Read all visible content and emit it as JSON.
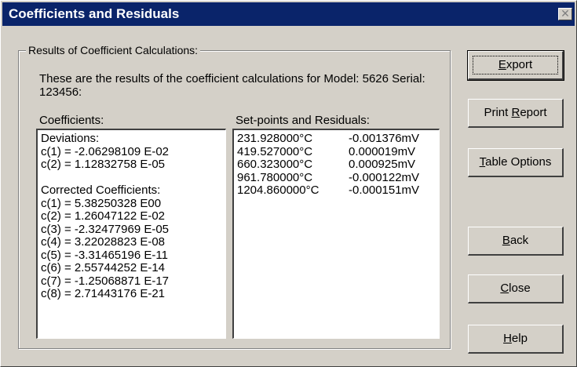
{
  "window": {
    "title": "Coefficients and Residuals",
    "close_glyph": "✕"
  },
  "group": {
    "legend": "Results of Coefficient Calculations:",
    "intro": "These are the results of the coefficient calculations for Model: 5626 Serial: 123456:"
  },
  "coefficients": {
    "label": "Coefficients:",
    "lines": [
      "Deviations:",
      "c(1) = -2.06298109 E-02",
      "c(2) = 1.12832758 E-05",
      "",
      "Corrected Coefficients:",
      "c(1) = 5.38250328 E00",
      "c(2) = 1.26047122 E-02",
      "c(3) = -2.32477969 E-05",
      "c(4) = 3.22028823 E-08",
      "c(5) = -3.31465196 E-11",
      "c(6) = 2.55744252 E-14",
      "c(7) = -1.25068871 E-17",
      "c(8) = 2.71443176 E-21"
    ]
  },
  "setpoints": {
    "label": "Set-points and Residuals:",
    "rows": [
      {
        "temp": "231.928000°C",
        "residual": "-0.001376mV"
      },
      {
        "temp": "419.527000°C",
        "residual": "0.000019mV"
      },
      {
        "temp": "660.323000°C",
        "residual": "0.000925mV"
      },
      {
        "temp": "961.780000°C",
        "residual": "-0.000122mV"
      },
      {
        "temp": "1204.860000°C",
        "residual": "-0.000151mV"
      }
    ]
  },
  "buttons": {
    "export": {
      "pre": "",
      "key": "E",
      "post": "xport"
    },
    "print": {
      "pre": "Print ",
      "key": "R",
      "post": "eport"
    },
    "table": {
      "pre": "",
      "key": "T",
      "post": "able Options"
    },
    "back": {
      "pre": "",
      "key": "B",
      "post": "ack"
    },
    "close": {
      "pre": "",
      "key": "C",
      "post": "lose"
    },
    "help": {
      "pre": "",
      "key": "H",
      "post": "elp"
    }
  }
}
